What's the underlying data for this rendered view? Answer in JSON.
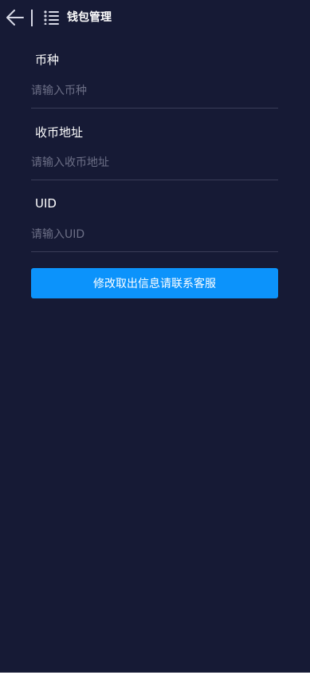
{
  "header": {
    "title": "钱包管理"
  },
  "form": {
    "currency": {
      "label": "币种",
      "placeholder": "请输入币种",
      "value": ""
    },
    "address": {
      "label": "收币地址",
      "placeholder": "请输入收币地址",
      "value": ""
    },
    "uid": {
      "label": "UID",
      "placeholder": "请输入UID",
      "value": ""
    },
    "submit_label": "修改取出信息请联系客服"
  },
  "colors": {
    "background": "#161a35",
    "accent": "#0c93fb",
    "placeholder": "#6c6f86",
    "divider": "#3a3d58"
  },
  "icons": {
    "back": "arrow-left-icon",
    "menu": "list-menu-icon"
  }
}
